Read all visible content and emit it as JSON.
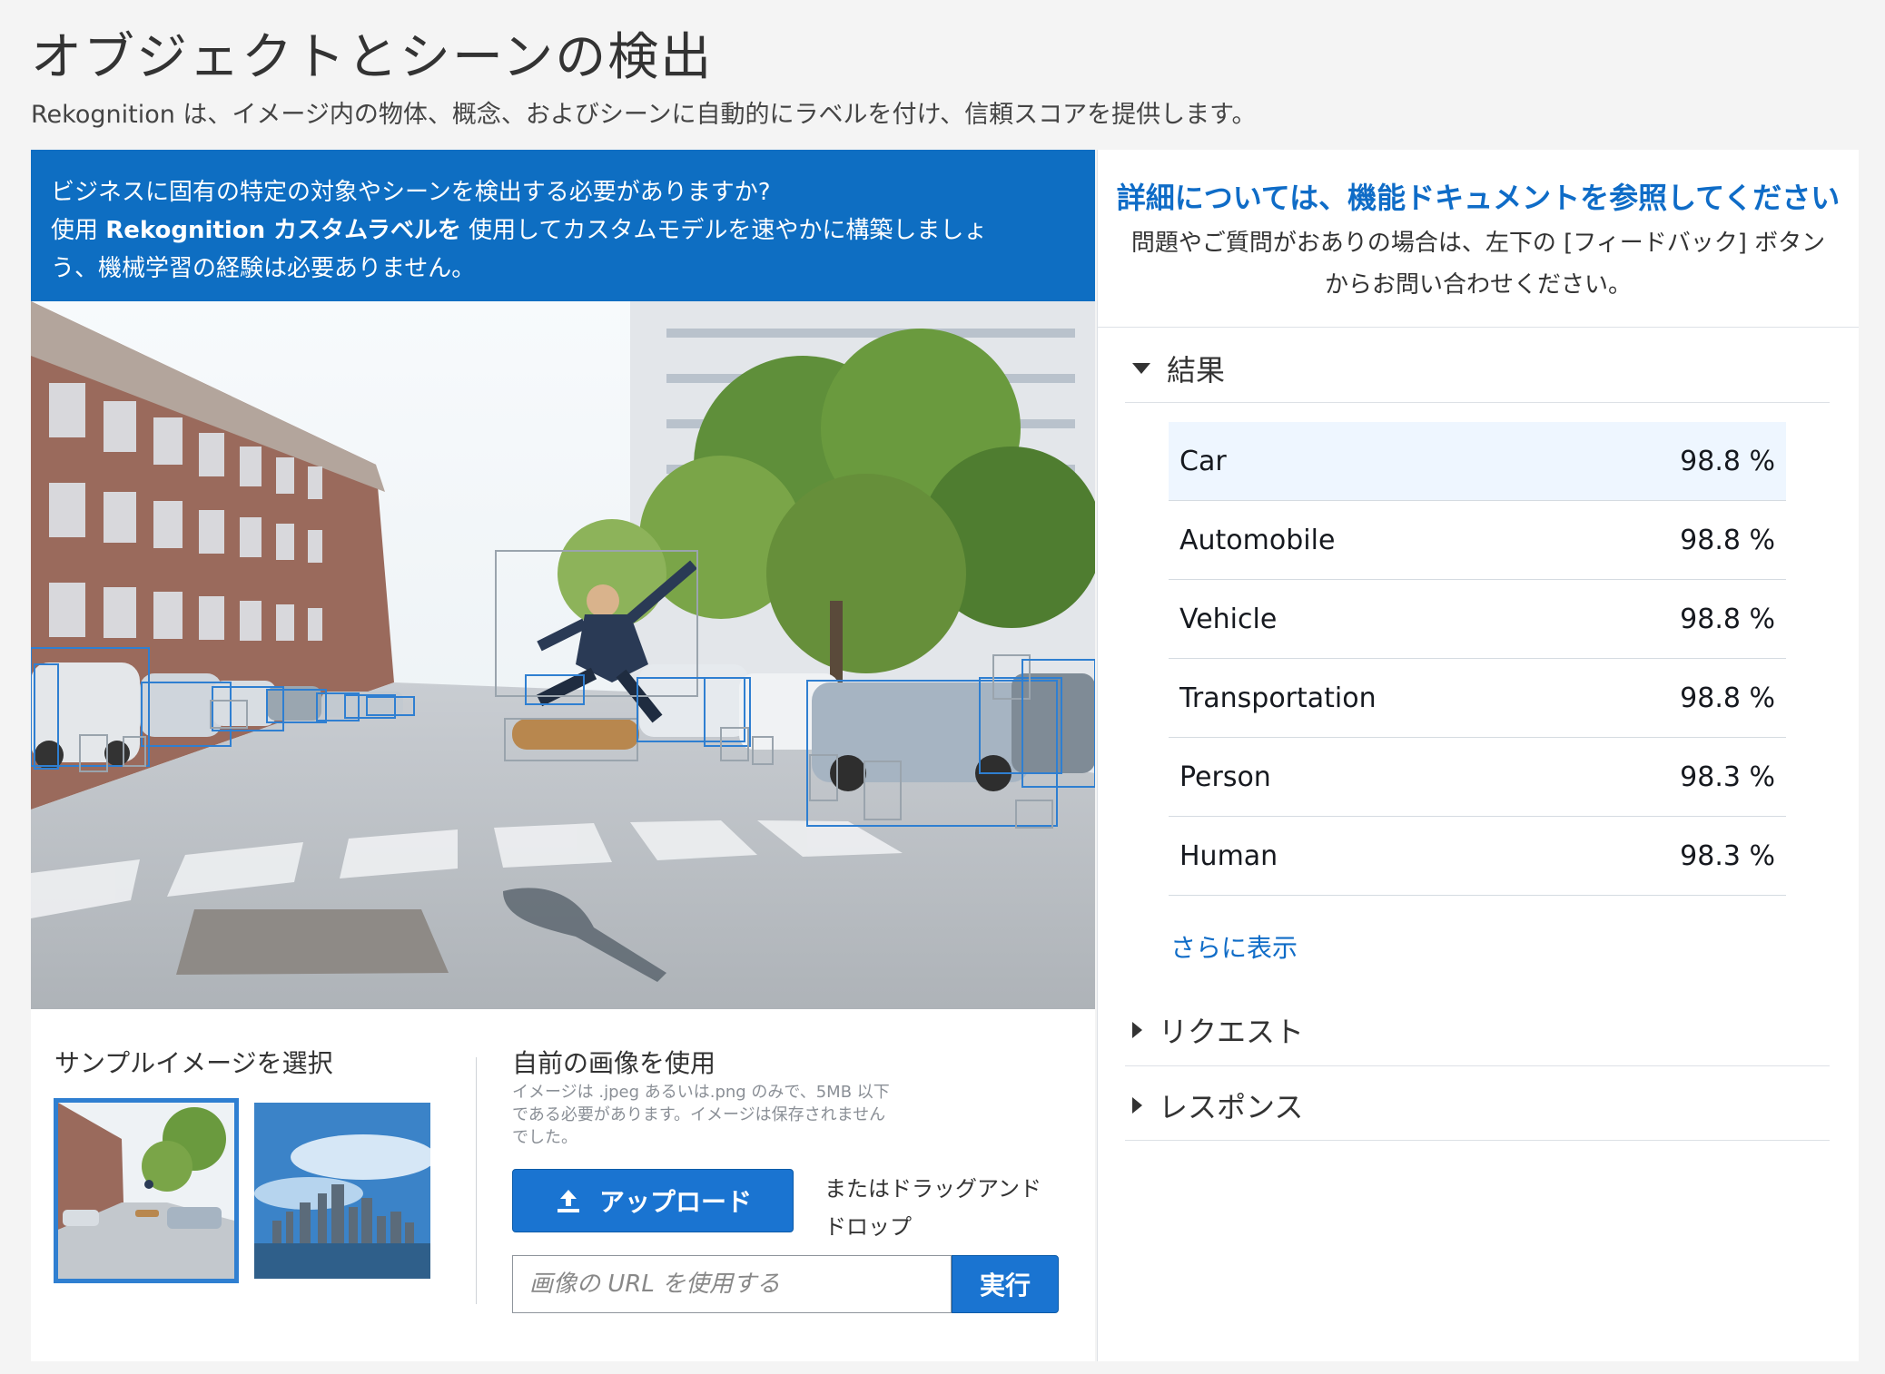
{
  "page": {
    "title": "オブジェクトとシーンの検出",
    "subtitle": "Rekognition は、イメージ内の物体、概念、およびシーンに自動的にラベルを付け、信頼スコアを提供します。"
  },
  "banner": {
    "line1": "ビジネスに固有の特定の対象やシーンを検出する必要がありますか?",
    "line2_prefix": "使用 ",
    "line2_bold": "Rekognition カスタムラベルを",
    "line2_suffix": " 使用してカスタムモデルを速やかに構築しましょ",
    "line3": "う、機械学習の経験は必要ありません。"
  },
  "samples": {
    "title": "サンプルイメージを選択"
  },
  "own_image": {
    "title": "自前の画像を使用",
    "note": "イメージは .jpeg あるいは.png のみで、5MB 以下である必要があります。イメージは保存されませんでした。",
    "upload_label": "アップロード",
    "drag_label": "またはドラッグアンドドロップ",
    "url_placeholder": "画像の URL を使用する",
    "go_label": "実行"
  },
  "right": {
    "doc_link": "詳細については、機能ドキュメントを参照してください",
    "doc_text_1": "問題やご質問がおありの場合は、左下の [フィードバック] ボタン",
    "doc_text_2": "からお問い合わせください。",
    "results_label": "結果",
    "show_more": "さらに表示",
    "request_label": "リクエスト",
    "response_label": "レスポンス"
  },
  "results": [
    {
      "label": "Car",
      "score": "98.8 %"
    },
    {
      "label": "Automobile",
      "score": "98.8 %"
    },
    {
      "label": "Vehicle",
      "score": "98.8 %"
    },
    {
      "label": "Transportation",
      "score": "98.8 %"
    },
    {
      "label": "Person",
      "score": "98.3 %"
    },
    {
      "label": "Human",
      "score": "98.3 %"
    }
  ],
  "colors": {
    "accent": "#0e6ec2",
    "link": "#0f6cc7",
    "button": "#1a74d1",
    "highlight_row": "#eef6ff"
  }
}
